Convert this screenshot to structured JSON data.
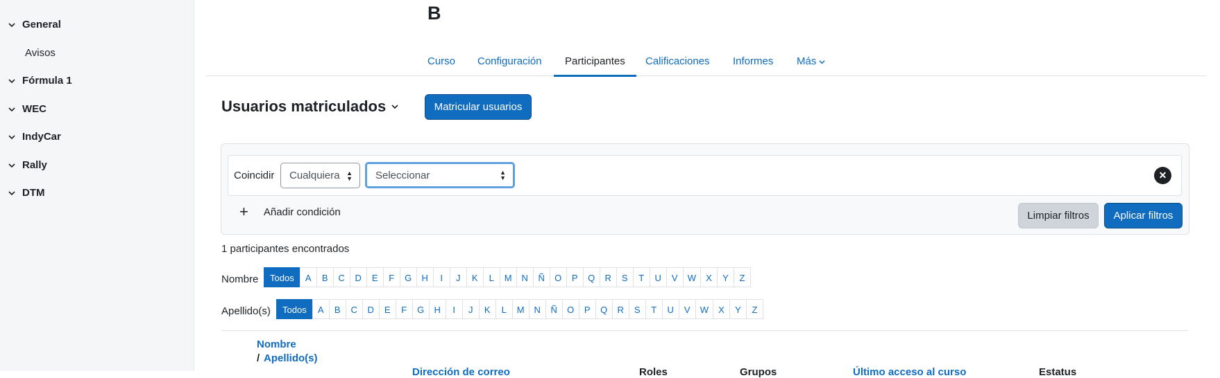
{
  "sidebar": {
    "sections": [
      {
        "label": "General",
        "items": [
          "Avisos"
        ]
      },
      {
        "label": "Fórmula 1"
      },
      {
        "label": "WEC"
      },
      {
        "label": "IndyCar"
      },
      {
        "label": "Rally"
      },
      {
        "label": "DTM"
      }
    ]
  },
  "course": {
    "title": "B"
  },
  "nav": {
    "tabs": [
      {
        "label": "Curso"
      },
      {
        "label": "Configuración"
      },
      {
        "label": "Participantes",
        "active": true
      },
      {
        "label": "Calificaciones"
      },
      {
        "label": "Informes"
      },
      {
        "label": "Más"
      }
    ]
  },
  "page": {
    "title": "Usuarios matriculados",
    "enrol_button": "Matricular usuarios"
  },
  "filters": {
    "match_label": "Coincidir",
    "match_value": "Cualquiera",
    "type_value": "Seleccionar",
    "add_condition": "Añadir condición",
    "clear": "Limpiar filtros",
    "apply": "Aplicar filtros"
  },
  "results": {
    "count_text": "1 participantes encontrados"
  },
  "initials": {
    "first_label": "Nombre",
    "last_label": "Apellido(s)",
    "all": "Todos",
    "letters": [
      "A",
      "B",
      "C",
      "D",
      "E",
      "F",
      "G",
      "H",
      "I",
      "J",
      "K",
      "L",
      "M",
      "N",
      "Ñ",
      "O",
      "P",
      "Q",
      "R",
      "S",
      "T",
      "U",
      "V",
      "W",
      "X",
      "Y",
      "Z"
    ]
  },
  "table": {
    "headers": {
      "name": "Nombre",
      "slash": "/",
      "surname": "Apellido(s)",
      "email": "Dirección de correo",
      "roles": "Roles",
      "groups": "Grupos",
      "last_access": "Último acceso al curso",
      "status": "Estatus"
    }
  },
  "colors": {
    "accent": "#0f6cbf",
    "sidebar_bg": "#f5f6f8"
  }
}
